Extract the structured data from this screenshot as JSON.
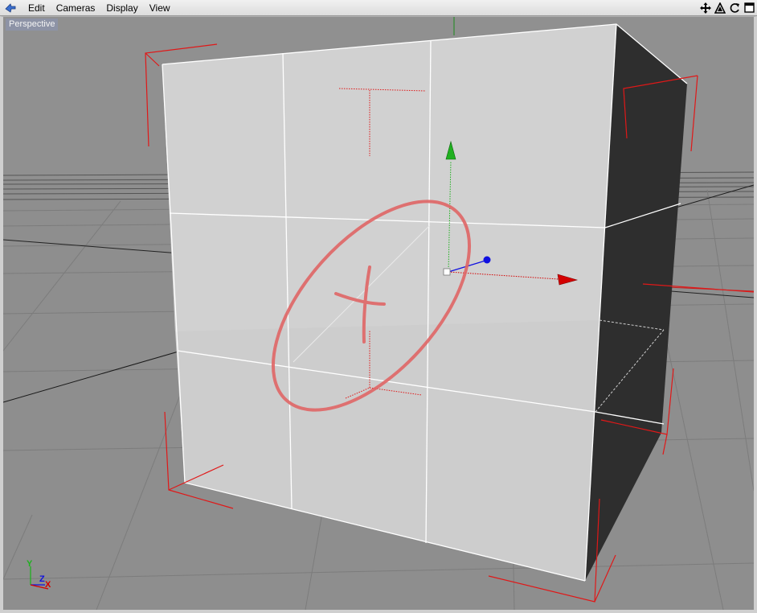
{
  "menu": {
    "items": [
      {
        "label": "Edit"
      },
      {
        "label": "Cameras"
      },
      {
        "label": "Display"
      },
      {
        "label": "View"
      }
    ]
  },
  "nav_icons": [
    "move-view-icon",
    "rotate-view-icon",
    "refresh-view-icon",
    "maximize-view-icon"
  ],
  "viewport": {
    "label": "Perspective",
    "axis_letters": {
      "y": "Y",
      "z": "Z",
      "x": "X"
    }
  },
  "colors": {
    "menubar": "#e6e6e6",
    "viewport_bg": "#8e8e8e",
    "view_label_bg": "#8d93a6",
    "bounding_box": "#e01818",
    "annotation": "#e06666",
    "axis_x": "#d40000",
    "axis_y": "#20b020",
    "axis_z": "#1010e0",
    "cube_face": "#cfcfcf",
    "cube_side": "#2e2e2e"
  }
}
